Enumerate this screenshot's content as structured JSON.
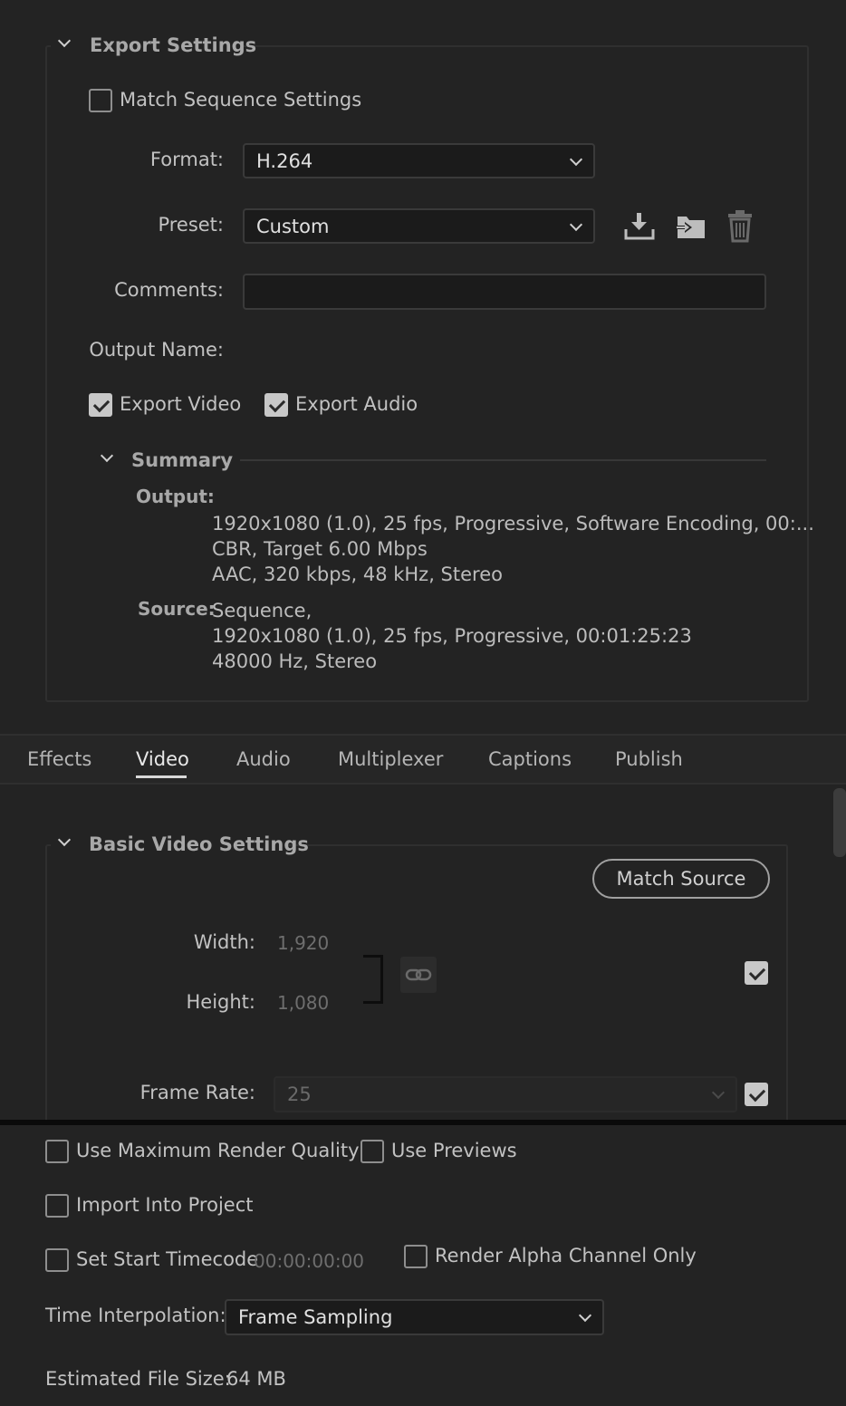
{
  "export_settings": {
    "title": "Export Settings",
    "match_sequence_label": "Match Sequence Settings",
    "format_label": "Format:",
    "format_value": "H.264",
    "preset_label": "Preset:",
    "preset_value": "Custom",
    "comments_label": "Comments:",
    "comments_value": "",
    "output_name_label": "Output Name:",
    "export_video_label": "Export Video",
    "export_audio_label": "Export Audio",
    "export_video_checked": true,
    "export_audio_checked": true,
    "match_sequence_checked": false
  },
  "summary": {
    "title": "Summary",
    "output_label": "Output:",
    "output_lines": [
      "1920x1080 (1.0), 25 fps, Progressive, Software Encoding, 00:...",
      "CBR, Target 6.00 Mbps",
      "AAC, 320 kbps, 48 kHz, Stereo"
    ],
    "source_label": "Source:",
    "source_lines": [
      "Sequence,",
      "1920x1080 (1.0), 25 fps, Progressive, 00:01:25:23",
      "48000 Hz, Stereo"
    ]
  },
  "tabs": [
    "Effects",
    "Video",
    "Audio",
    "Multiplexer",
    "Captions",
    "Publish"
  ],
  "active_tab": "Video",
  "basic_video": {
    "title": "Basic Video Settings",
    "match_source_label": "Match Source",
    "width_label": "Width:",
    "width_value": "1,920",
    "height_label": "Height:",
    "height_value": "1,080",
    "frame_rate_label": "Frame Rate:",
    "frame_rate_value": "25"
  },
  "bottom": {
    "max_render_quality_label": "Use Maximum Render Quality",
    "use_previews_label": "Use Previews",
    "import_into_project_label": "Import Into Project",
    "set_start_timecode_label": "Set Start Timecode",
    "start_timecode_value": "00:00:00:00",
    "render_alpha_label": "Render Alpha Channel Only",
    "time_interpolation_label": "Time Interpolation:",
    "time_interpolation_value": "Frame Sampling",
    "estimated_file_size_label": "Estimated File Size:",
    "estimated_file_size_value": "64 MB"
  },
  "icons": [
    "chevron-down-icon",
    "save-preset-icon",
    "import-preset-icon",
    "trash-icon",
    "link-icon",
    "checkbox-icon"
  ],
  "colors": {
    "background": "#232323",
    "field": "#1b1b1b",
    "text": "#c2c2c2",
    "dim": "#6e6e6e"
  }
}
